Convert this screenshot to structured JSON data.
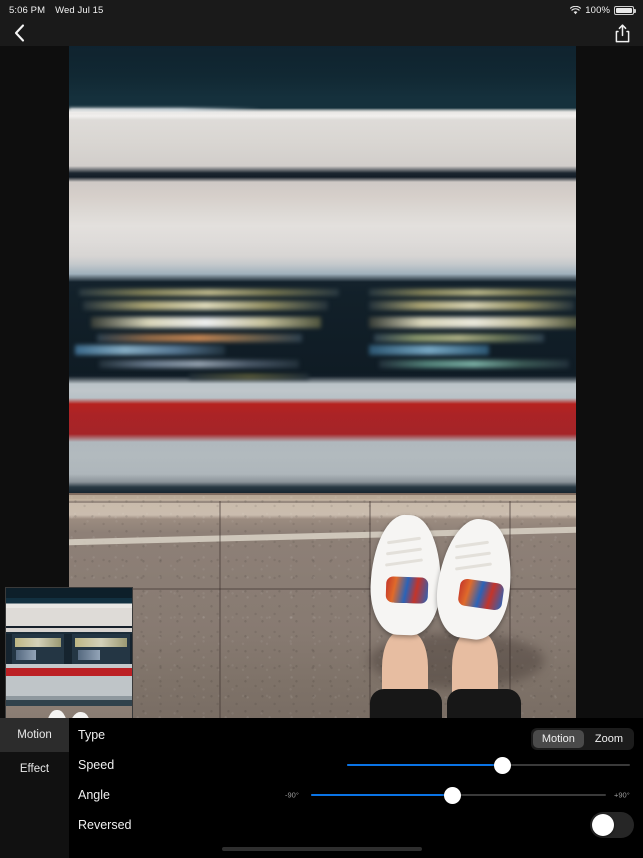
{
  "status_bar": {
    "time": "5:06 PM",
    "date": "Wed Jul 15",
    "battery_percent": "100%",
    "wifi_icon": "wifi-icon",
    "battery_icon": "battery-full-icon"
  },
  "nav_bar": {
    "back_icon": "chevron-left-icon",
    "share_icon": "share-upload-icon"
  },
  "sidebar": {
    "items": [
      {
        "label": "Motion",
        "active": true
      },
      {
        "label": "Effect",
        "active": false
      }
    ]
  },
  "controls": {
    "rows": [
      {
        "label": "Type"
      },
      {
        "label": "Speed"
      },
      {
        "label": "Angle"
      },
      {
        "label": "Reversed"
      }
    ],
    "type": {
      "label": "Type",
      "options": [
        {
          "label": "Motion",
          "selected": true
        },
        {
          "label": "Zoom",
          "selected": false
        }
      ]
    },
    "speed": {
      "label": "Speed",
      "value_percent": 55,
      "min_label": "",
      "max_label": ""
    },
    "angle": {
      "label": "Angle",
      "value_percent": 48,
      "min_label": "-90°",
      "max_label": "+90°"
    },
    "reversed": {
      "label": "Reversed",
      "value": "off"
    }
  },
  "colors": {
    "accent": "#0a74e6",
    "panel_bg": "#000000",
    "sidebar_bg": "#111111",
    "sidebar_active": "#2c2c2c",
    "segment_active": "#4a4a4a",
    "track": "#3a3a3a",
    "knob": "#ffffff",
    "train_red_stripe": "#b6221f"
  },
  "photo": {
    "name": "blurred-train-and-feet-photo",
    "description_alt": "motion-blurred train with feet on platform"
  },
  "thumbnail": {
    "name": "original-photo-thumbnail"
  },
  "home_indicator": {
    "name": "home-indicator"
  }
}
